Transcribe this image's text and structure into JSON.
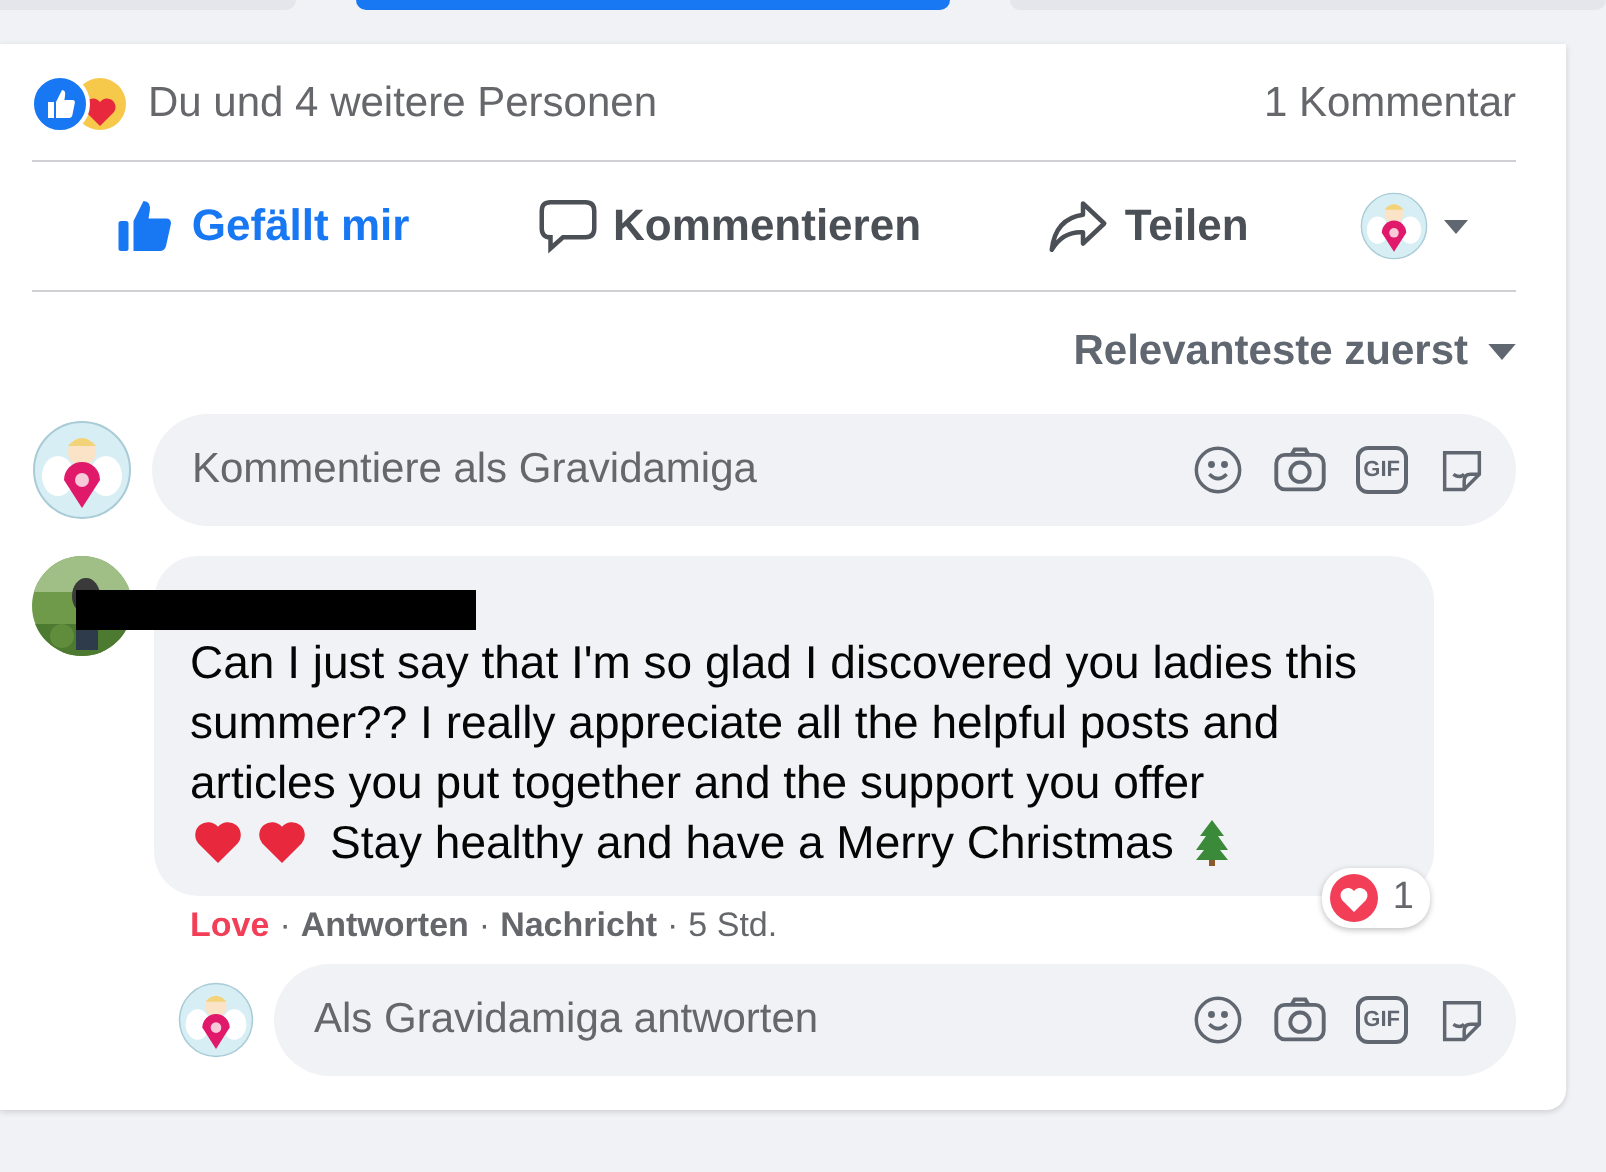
{
  "top_tabs": [
    {
      "selected": false
    },
    {
      "selected": true
    },
    {
      "selected": false
    }
  ],
  "reactions": {
    "summary": "Du und 4 weitere Personen",
    "comment_count": "1 Kommentar"
  },
  "actions": [
    {
      "kind": "like",
      "label": "Gefällt mir",
      "selected": true
    },
    {
      "kind": "comment",
      "label": "Kommentieren",
      "selected": false
    },
    {
      "kind": "share",
      "label": "Teilen",
      "selected": false
    }
  ],
  "sort": {
    "label": "Relevanteste zuerst"
  },
  "composer": {
    "placeholder": "Kommentiere als Gravidamiga",
    "gif_label": "GIF"
  },
  "comment": {
    "name_redacted": true,
    "lines": "Can I just say that I'm so glad I discovered you ladies this summer?? I really appreciate all the helpful posts and articles you put together and the support you offer",
    "last_line": "Stay healthy and have a Merry Christmas",
    "reaction_count": "1",
    "loved": true,
    "meta_separator": "·",
    "meta": [
      {
        "kind": "love",
        "label": "Love"
      },
      {
        "kind": "link",
        "label": "Antworten"
      },
      {
        "kind": "link",
        "label": "Nachricht"
      },
      {
        "kind": "time",
        "label": "5 Std."
      }
    ]
  },
  "reply": {
    "placeholder": "Als Gravidamiga antworten",
    "gif_label": "GIF"
  }
}
